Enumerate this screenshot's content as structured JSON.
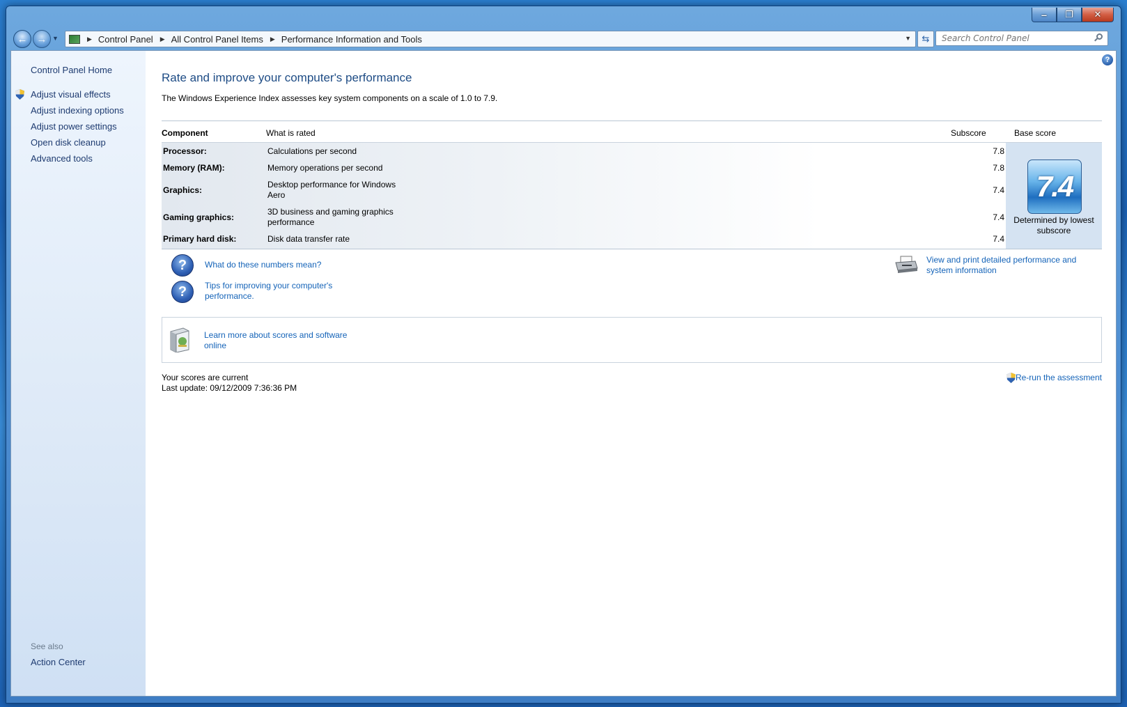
{
  "window": {
    "caption": {
      "minimize": "‒",
      "maximize": "❐",
      "close": "✕"
    }
  },
  "address": {
    "crumbs": [
      "Control Panel",
      "All Control Panel Items",
      "Performance Information and Tools"
    ],
    "search_placeholder": "Search Control Panel"
  },
  "sidebar": {
    "home": "Control Panel Home",
    "tasks": [
      "Adjust visual effects",
      "Adjust indexing options",
      "Adjust power settings",
      "Open disk cleanup",
      "Advanced tools"
    ],
    "see_also_label": "See also",
    "see_also_items": [
      "Action Center"
    ]
  },
  "main": {
    "title": "Rate and improve your computer's performance",
    "description": "The Windows Experience Index assesses key system components on a scale of 1.0 to 7.9.",
    "table": {
      "headers": {
        "component": "Component",
        "what": "What is rated",
        "subscore": "Subscore",
        "base": "Base score"
      },
      "rows": [
        {
          "component": "Processor:",
          "what": "Calculations per second",
          "subscore": "7.8"
        },
        {
          "component": "Memory (RAM):",
          "what": "Memory operations per second",
          "subscore": "7.8"
        },
        {
          "component": "Graphics:",
          "what": "Desktop performance for Windows Aero",
          "subscore": "7.4"
        },
        {
          "component": "Gaming graphics:",
          "what": "3D business and gaming graphics performance",
          "subscore": "7.4"
        },
        {
          "component": "Primary hard disk:",
          "what": "Disk data transfer rate",
          "subscore": "7.4"
        }
      ],
      "base_score": "7.4",
      "base_caption": "Determined by lowest subscore"
    },
    "links": {
      "numbers": "What do these numbers mean?",
      "tips": "Tips for improving your computer's performance.",
      "print": "View and print detailed performance and system information",
      "learn": "Learn more about scores and software online"
    },
    "status": {
      "current": "Your scores are current",
      "last_update": "Last update: 09/12/2009 7:36:36 PM"
    },
    "rerun": "Re-run the assessment"
  },
  "colors": {
    "link": "#1463b8",
    "title": "#1e4c85",
    "sidebar_link": "#1e3b70"
  }
}
